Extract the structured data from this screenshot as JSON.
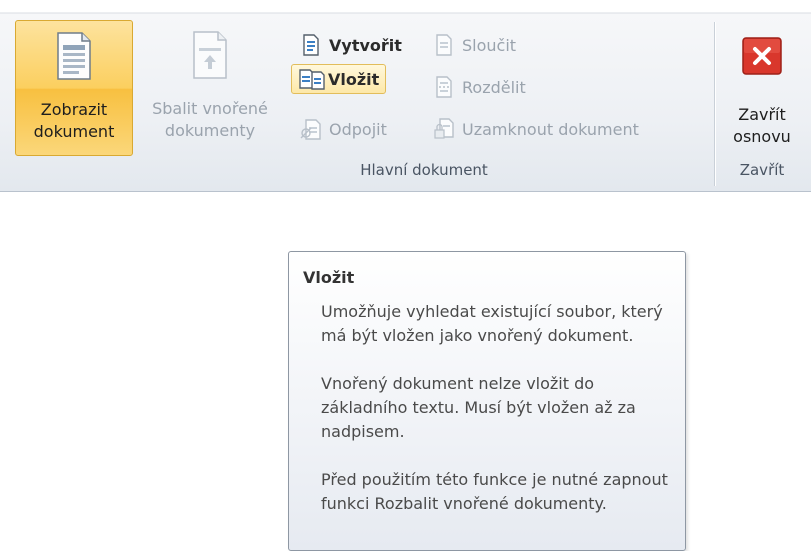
{
  "ribbon": {
    "master_group": {
      "label": "Hlavní dokument",
      "show_document": {
        "label_line1": "Zobrazit",
        "label_line2": "dokument",
        "icon": "document-view-icon"
      },
      "collapse_subdocs": {
        "label_line1": "Sbalit vnořené",
        "label_line2": "dokumenty",
        "icon": "collapse-subdocuments-icon"
      },
      "create": {
        "label": "Vytvořit",
        "icon": "create-subdocument-icon"
      },
      "insert": {
        "label": "Vložit",
        "icon": "insert-subdocument-icon"
      },
      "unlink": {
        "label": "Odpojit",
        "icon": "unlink-subdocument-icon"
      },
      "merge": {
        "label": "Sloučit",
        "icon": "merge-subdocument-icon"
      },
      "split": {
        "label": "Rozdělit",
        "icon": "split-subdocument-icon"
      },
      "lock": {
        "label": "Uzamknout dokument",
        "icon": "lock-document-icon"
      }
    },
    "close_group": {
      "label": "Zavřít",
      "close_outline": {
        "label_line1": "Zavřít",
        "label_line2": "osnovu",
        "icon": "close-icon"
      }
    }
  },
  "tooltip": {
    "title": "Vložit",
    "paragraphs": [
      "Umožňuje vyhledat existující soubor, který má být vložen jako vnořený dokument.",
      "Vnořený dokument nelze vložit do základního textu. Musí být vložen až za nadpisem.",
      "Před použitím této funkce je nutné zapnout funkci Rozbalit vnořené dokumenty."
    ]
  },
  "colors": {
    "active_button": "#fbcf5f",
    "close_red": "#d9372c",
    "disabled_text": "#9aa3ad"
  }
}
